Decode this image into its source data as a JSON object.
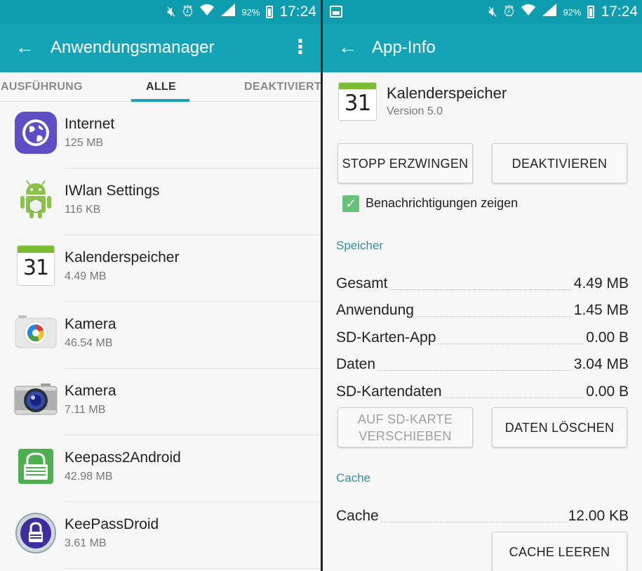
{
  "status_bar": {
    "battery_percent": "92%",
    "time": "17:24",
    "icons": [
      "mute-icon",
      "alarm-icon",
      "wifi-icon",
      "signal-icon",
      "battery-icon"
    ]
  },
  "left": {
    "title": "Anwendungsmanager",
    "tabs": [
      {
        "label": "AUSFÜHRUNG",
        "active": false
      },
      {
        "label": "ALLE",
        "active": true
      },
      {
        "label": "DEAKTIVIERT",
        "active": false
      }
    ],
    "apps": [
      {
        "name": "Internet",
        "size": "125 MB",
        "icon": "internet-icon"
      },
      {
        "name": "IWlan Settings",
        "size": "116 KB",
        "icon": "android-icon"
      },
      {
        "name": "Kalenderspeicher",
        "size": "4.49 MB",
        "icon": "calendar-icon",
        "icon_text": "31"
      },
      {
        "name": "Kamera",
        "size": "46.54 MB",
        "icon": "camera-icon"
      },
      {
        "name": "Kamera",
        "size": "7.11 MB",
        "icon": "camera-icon"
      },
      {
        "name": "Keepass2Android",
        "size": "42.98 MB",
        "icon": "keepass2android-icon"
      },
      {
        "name": "KeePassDroid",
        "size": "3.61 MB",
        "icon": "keepassdroid-icon"
      }
    ]
  },
  "right": {
    "title": "App-Info",
    "app": {
      "name": "Kalenderspeicher",
      "version": "Version 5.0",
      "icon_text": "31"
    },
    "buttons": {
      "force_stop": "STOPP ERZWINGEN",
      "disable": "DEAKTIVIEREN",
      "move_sd_line1": "AUF SD-KARTE",
      "move_sd_line2": "VERSCHIEBEN",
      "clear_data": "DATEN LÖSCHEN",
      "clear_cache": "CACHE LEEREN"
    },
    "notifications": {
      "label": "Benachrichtigungen zeigen",
      "checked": true
    },
    "storage": {
      "heading": "Speicher",
      "rows": [
        {
          "label": "Gesamt",
          "value": "4.49 MB"
        },
        {
          "label": "Anwendung",
          "value": "1.45 MB"
        },
        {
          "label": "SD-Karten-App",
          "value": "0.00 B"
        },
        {
          "label": "Daten",
          "value": "3.04 MB"
        },
        {
          "label": "SD-Kartendaten",
          "value": "0.00 B"
        }
      ]
    },
    "cache": {
      "heading": "Cache",
      "rows": [
        {
          "label": "Cache",
          "value": "12.00 KB"
        }
      ]
    }
  },
  "colors": {
    "status_bar": "#0e9dae",
    "app_bar": "#15a3b6",
    "accent": "#15a3b6",
    "section_heading": "#3a8da0",
    "checkbox": "#68c07c"
  }
}
